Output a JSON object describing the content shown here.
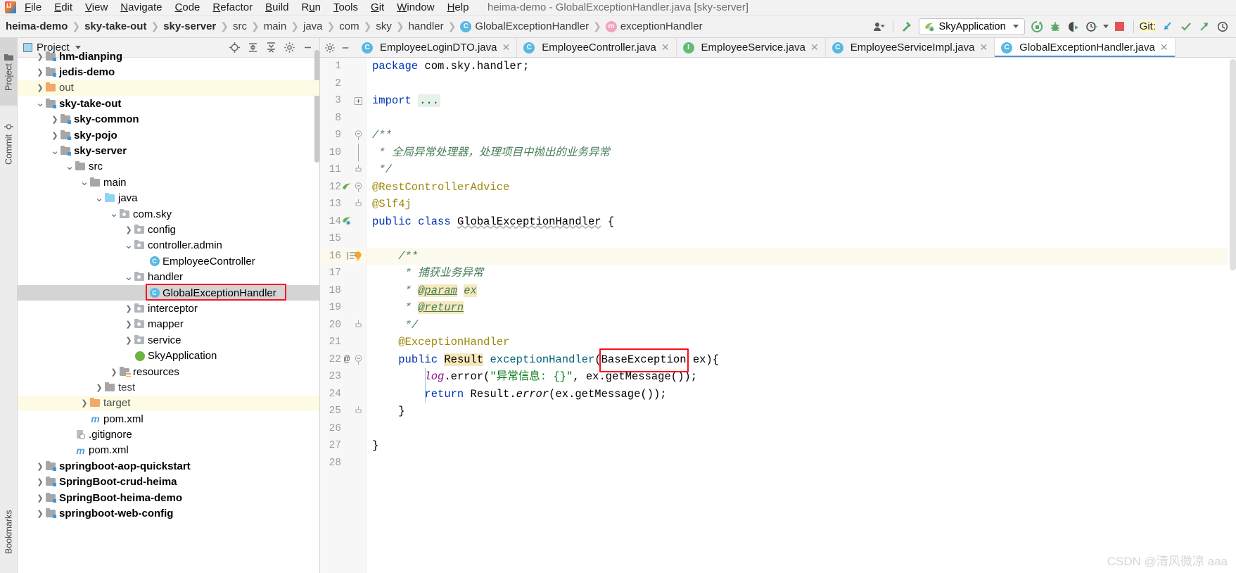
{
  "window": {
    "title": "heima-demo - GlobalExceptionHandler.java [sky-server]"
  },
  "menubar": {
    "items": [
      {
        "label": "File",
        "mnemonic": "F"
      },
      {
        "label": "Edit",
        "mnemonic": "E"
      },
      {
        "label": "View",
        "mnemonic": "V"
      },
      {
        "label": "Navigate",
        "mnemonic": "N"
      },
      {
        "label": "Code",
        "mnemonic": "C"
      },
      {
        "label": "Refactor",
        "mnemonic": "R"
      },
      {
        "label": "Build",
        "mnemonic": "B"
      },
      {
        "label": "Run",
        "mnemonic": "u"
      },
      {
        "label": "Tools",
        "mnemonic": "T"
      },
      {
        "label": "Git",
        "mnemonic": "G"
      },
      {
        "label": "Window",
        "mnemonic": "W"
      },
      {
        "label": "Help",
        "mnemonic": "H"
      }
    ]
  },
  "breadcrumb": {
    "items": [
      {
        "label": "heima-demo",
        "style": "bold"
      },
      {
        "label": "sky-take-out",
        "style": "bold"
      },
      {
        "label": "sky-server",
        "style": "bold"
      },
      {
        "label": "src",
        "style": "normal"
      },
      {
        "label": "main",
        "style": "normal"
      },
      {
        "label": "java",
        "style": "normal"
      },
      {
        "label": "com",
        "style": "normal"
      },
      {
        "label": "sky",
        "style": "normal"
      },
      {
        "label": "handler",
        "style": "normal"
      },
      {
        "label": "GlobalExceptionHandler",
        "style": "normal",
        "icon": "class-icon",
        "icon_letter": "C"
      },
      {
        "label": "exceptionHandler",
        "style": "normal",
        "icon": "method-icon",
        "icon_letter": "m"
      }
    ]
  },
  "toolbar": {
    "run_configuration": "SkyApplication",
    "run_config_icon": "spring-boot-icon",
    "buttons": [
      {
        "name": "user-settings-icon",
        "label": ""
      },
      {
        "name": "build-hammer-icon",
        "label": ""
      },
      {
        "name": "run-icon",
        "label": ""
      },
      {
        "name": "debug-icon",
        "label": ""
      },
      {
        "name": "run-with-coverage-icon",
        "label": ""
      },
      {
        "name": "profiler-icon",
        "label": ""
      },
      {
        "name": "stop-icon",
        "label": ""
      }
    ],
    "git_label": "Git:",
    "git_buttons": [
      {
        "name": "git-update-project-icon"
      },
      {
        "name": "git-commit-icon"
      },
      {
        "name": "git-push-icon"
      },
      {
        "name": "git-history-icon"
      }
    ]
  },
  "left_toolstrip": {
    "tabs": [
      {
        "label": "Project",
        "icon": "project-folder-icon",
        "active": true
      },
      {
        "label": "Commit",
        "icon": "commit-icon",
        "active": false
      },
      {
        "label": "Bookmarks",
        "icon": "bookmarks-icon",
        "active": false
      }
    ]
  },
  "project_panel": {
    "title": "Project",
    "title_icon": "project-view-icon",
    "actions": [
      {
        "name": "locate-file-icon"
      },
      {
        "name": "expand-all-icon"
      },
      {
        "name": "collapse-all-icon"
      },
      {
        "name": "settings-gear-icon"
      },
      {
        "name": "hide-panel-icon"
      }
    ],
    "tree": [
      {
        "label": "hm-dianping",
        "indent": 1,
        "arrow": "right",
        "icon": "module",
        "bold": true,
        "clipped": true
      },
      {
        "label": "jedis-demo",
        "indent": 1,
        "arrow": "right",
        "icon": "module",
        "bold": true
      },
      {
        "label": "out",
        "indent": 1,
        "arrow": "right",
        "icon": "excluded",
        "bold": false,
        "dim": true,
        "row_highlight": "yellow"
      },
      {
        "label": "sky-take-out",
        "indent": 1,
        "arrow": "down",
        "icon": "module",
        "bold": true
      },
      {
        "label": "sky-common",
        "indent": 2,
        "arrow": "right",
        "icon": "module",
        "bold": true
      },
      {
        "label": "sky-pojo",
        "indent": 2,
        "arrow": "right",
        "icon": "module",
        "bold": true
      },
      {
        "label": "sky-server",
        "indent": 2,
        "arrow": "down",
        "icon": "module",
        "bold": true
      },
      {
        "label": "src",
        "indent": 3,
        "arrow": "down",
        "icon": "plain",
        "bold": false
      },
      {
        "label": "main",
        "indent": 4,
        "arrow": "down",
        "icon": "plain",
        "bold": false
      },
      {
        "label": "java",
        "indent": 5,
        "arrow": "down",
        "icon": "source",
        "bold": false
      },
      {
        "label": "com.sky",
        "indent": 6,
        "arrow": "down",
        "icon": "package",
        "bold": false
      },
      {
        "label": "config",
        "indent": 7,
        "arrow": "right",
        "icon": "package",
        "bold": false
      },
      {
        "label": "controller.admin",
        "indent": 7,
        "arrow": "down",
        "icon": "package",
        "bold": false
      },
      {
        "label": "EmployeeController",
        "indent": 8,
        "arrow": "none",
        "icon": "class",
        "bold": false
      },
      {
        "label": "handler",
        "indent": 7,
        "arrow": "down",
        "icon": "package",
        "bold": false
      },
      {
        "label": "GlobalExceptionHandler",
        "indent": 8,
        "arrow": "none",
        "icon": "class",
        "bold": false,
        "row_highlight": "selected",
        "annotated": true
      },
      {
        "label": "interceptor",
        "indent": 7,
        "arrow": "right",
        "icon": "package",
        "bold": false
      },
      {
        "label": "mapper",
        "indent": 7,
        "arrow": "right",
        "icon": "package",
        "bold": false
      },
      {
        "label": "service",
        "indent": 7,
        "arrow": "right",
        "icon": "package",
        "bold": false
      },
      {
        "label": "SkyApplication",
        "indent": 7,
        "arrow": "none",
        "icon": "spring-class",
        "bold": false
      },
      {
        "label": "resources",
        "indent": 6,
        "arrow": "right",
        "icon": "resources",
        "bold": false
      },
      {
        "label": "test",
        "indent": 5,
        "arrow": "right",
        "icon": "plain",
        "bold": false,
        "dim": true
      },
      {
        "label": "target",
        "indent": 4,
        "arrow": "right",
        "icon": "excluded",
        "bold": false,
        "dim": true,
        "row_highlight": "yellow"
      },
      {
        "label": "pom.xml",
        "indent": 4,
        "arrow": "none",
        "icon": "maven",
        "bold": false
      },
      {
        "label": ".gitignore",
        "indent": 3,
        "arrow": "none",
        "icon": "gitignore",
        "bold": false
      },
      {
        "label": "pom.xml",
        "indent": 3,
        "arrow": "none",
        "icon": "maven",
        "bold": false
      },
      {
        "label": "springboot-aop-quickstart",
        "indent": 1,
        "arrow": "right",
        "icon": "module",
        "bold": true
      },
      {
        "label": "SpringBoot-crud-heima",
        "indent": 1,
        "arrow": "right",
        "icon": "module",
        "bold": true
      },
      {
        "label": "SpringBoot-heima-demo",
        "indent": 1,
        "arrow": "right",
        "icon": "module",
        "bold": true
      },
      {
        "label": "springboot-web-config",
        "indent": 1,
        "arrow": "right",
        "icon": "module",
        "bold": true,
        "clipped_bottom": true
      }
    ]
  },
  "editor_tabs": [
    {
      "label": "EmployeeLoginDTO.java",
      "icon_letter": "C",
      "icon_type": "class",
      "active": false,
      "closable": true
    },
    {
      "label": "EmployeeController.java",
      "icon_letter": "C",
      "icon_type": "class",
      "active": false,
      "closable": true
    },
    {
      "label": "EmployeeService.java",
      "icon_letter": "I",
      "icon_type": "interface",
      "active": false,
      "closable": true
    },
    {
      "label": "EmployeeServiceImpl.java",
      "icon_letter": "C",
      "icon_type": "class",
      "active": false,
      "closable": true
    },
    {
      "label": "GlobalExceptionHandler.java",
      "icon_letter": "C",
      "icon_type": "class",
      "active": true,
      "closable": true
    }
  ],
  "code": {
    "lines": [
      {
        "num": "1",
        "gutter_icon": "",
        "fold": "",
        "current": false
      },
      {
        "num": "2",
        "gutter_icon": "",
        "fold": "",
        "current": false
      },
      {
        "num": "3",
        "gutter_icon": "",
        "fold": "plus",
        "current": false
      },
      {
        "num": "8",
        "gutter_icon": "",
        "fold": "",
        "current": false
      },
      {
        "num": "9",
        "gutter_icon": "",
        "fold": "minus-top",
        "current": false
      },
      {
        "num": "10",
        "gutter_icon": "",
        "fold": "bar",
        "current": false
      },
      {
        "num": "11",
        "gutter_icon": "",
        "fold": "minus-bot",
        "current": false
      },
      {
        "num": "12",
        "gutter_icon": "spring-bean-icon",
        "fold": "minus-top",
        "current": false
      },
      {
        "num": "13",
        "gutter_icon": "",
        "fold": "minus-bot",
        "current": false
      },
      {
        "num": "14",
        "gutter_icon": "spring-class-icon",
        "fold": "",
        "current": false
      },
      {
        "num": "15",
        "gutter_icon": "",
        "fold": "",
        "current": false
      },
      {
        "num": "16",
        "gutter_icon": "intention-bulb-icon",
        "fold": "minus-top",
        "current": true
      },
      {
        "num": "17",
        "gutter_icon": "",
        "fold": "",
        "current": false
      },
      {
        "num": "18",
        "gutter_icon": "",
        "fold": "",
        "current": false
      },
      {
        "num": "19",
        "gutter_icon": "",
        "fold": "",
        "current": false
      },
      {
        "num": "20",
        "gutter_icon": "",
        "fold": "minus-bot",
        "current": false
      },
      {
        "num": "21",
        "gutter_icon": "",
        "fold": "",
        "current": false
      },
      {
        "num": "22",
        "gutter_icon": "override-icon",
        "fold": "minus-top",
        "current": false
      },
      {
        "num": "23",
        "gutter_icon": "",
        "fold": "",
        "current": false
      },
      {
        "num": "24",
        "gutter_icon": "",
        "fold": "",
        "current": false
      },
      {
        "num": "25",
        "gutter_icon": "",
        "fold": "minus-bot",
        "current": false
      },
      {
        "num": "26",
        "gutter_icon": "",
        "fold": "",
        "current": false
      },
      {
        "num": "27",
        "gutter_icon": "",
        "fold": "",
        "current": false
      },
      {
        "num": "28",
        "gutter_icon": "",
        "fold": "",
        "current": false
      }
    ],
    "text": [
      "package com.sky.handler;",
      "",
      "import ...",
      "",
      "/**",
      " * 全局异常处理器，处理项目中抛出的业务异常",
      " */",
      "@RestControllerAdvice",
      "@Slf4j",
      "public class GlobalExceptionHandler {",
      "",
      "    /**",
      "     * 捕获业务异常",
      "     * @param ex",
      "     * @return",
      "     */",
      "    @ExceptionHandler",
      "    public Result exceptionHandler(BaseException ex){",
      "        log.error(\"异常信息: {}\", ex.getMessage());",
      "        return Result.error(ex.getMessage());",
      "    }",
      "",
      "}",
      ""
    ]
  },
  "annotation": {
    "color": "#fc0d1c",
    "boxes": [
      {
        "name": "tree-globalexceptionhandler-highlight"
      },
      {
        "name": "code-baseexception-highlight"
      }
    ]
  },
  "watermark": {
    "text": "CSDN @清风微凉 aaa"
  }
}
